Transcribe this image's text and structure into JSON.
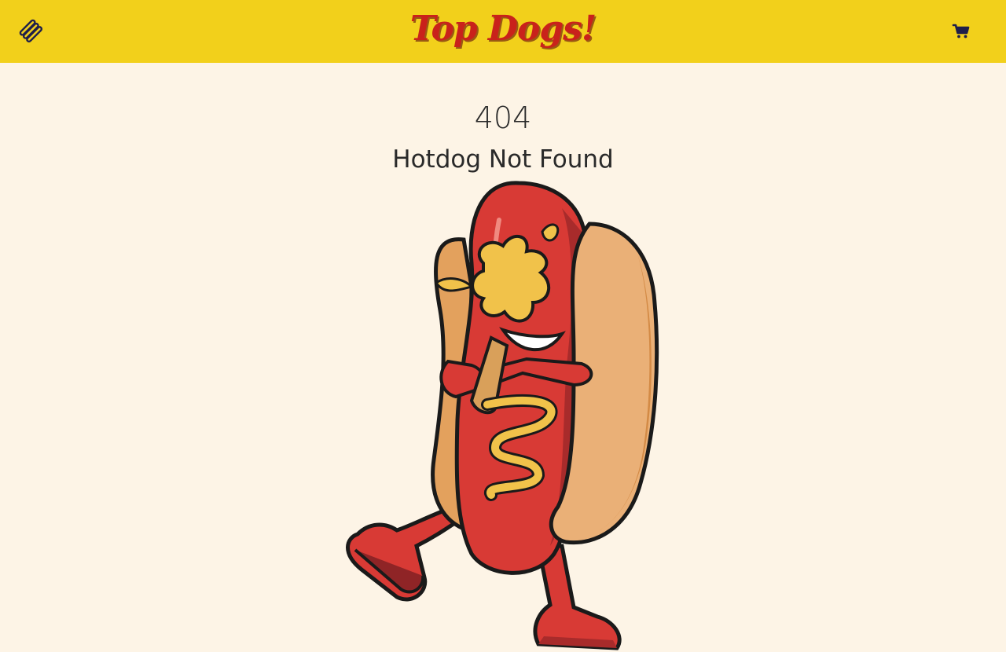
{
  "header": {
    "brand": "Top Dogs!",
    "menu_icon": "hotdog-menu-icon",
    "cart_icon": "shopping-cart-icon"
  },
  "main": {
    "code": "404",
    "message": "Hotdog Not Found",
    "illustration": "hotdog-mascot-illustration"
  },
  "colors": {
    "header_bg": "#f2d01b",
    "page_bg": "#fdf4e6",
    "brand": "#c9221b",
    "icon": "#1f1f4a"
  }
}
